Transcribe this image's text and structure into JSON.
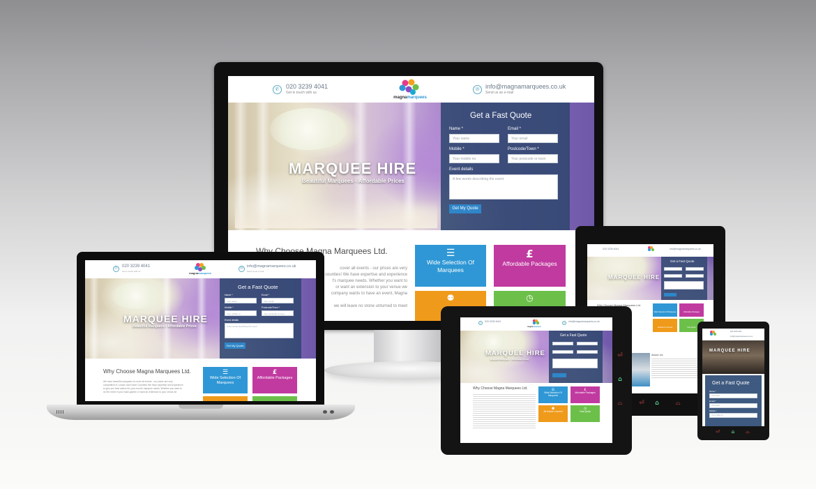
{
  "brand": {
    "logo_text_prefix": "magna",
    "logo_text_suffix": "marquees",
    "colors": {
      "teal": "#5fa9c0",
      "quote_panel": "#304870",
      "button": "#2f86c8",
      "tile_blue": "#2f97d5",
      "tile_magenta": "#c13aa0",
      "tile_orange": "#ef9a1a",
      "tile_green": "#6cc04a"
    }
  },
  "header": {
    "phone": "020 3239 4041",
    "phone_caption": "Get in touch with us",
    "email": "info@magnamarquees.co.uk",
    "email_caption": "Send us an e-mail",
    "phone_icon": "phone-icon",
    "email_icon": "mail-icon"
  },
  "hero": {
    "title": "MARQUEE HIRE",
    "subtitle": "Beautiful Marquees - Affordable Prices"
  },
  "quote_form": {
    "heading": "Get a Fast Quote",
    "name_label": "Name *",
    "name_placeholder": "Your name",
    "email_label": "Email *",
    "email_placeholder": "Your email",
    "mobile_label": "Mobile *",
    "mobile_placeholder": "Your mobile no.",
    "postcode_label": "Postcode/Town *",
    "postcode_placeholder": "Your postcode or town",
    "details_label": "Event details",
    "details_placeholder": "A few words describing the event",
    "submit_label": "Get My Quote"
  },
  "why": {
    "heading": "Why Choose Magna Marquees Ltd.",
    "text_lines": [
      "cover all events - our prices are very",
      "counties! We have expertise and experience",
      "t's marquee needs. Whether you want to",
      "or want an extension to your venue we",
      "company wants to have an event, Magna",
      "",
      "we will leave no stone unturned to meet"
    ],
    "laptop_text_lines": [
      "We have beautiful marquees to cover all events - our prices are very",
      "competitive in London and Home Counties! We have expertise and experience",
      "to give you best advice for your event's marquee needs. Whether you want to",
      "do the event in your back garden or want an extension to your venue we"
    ]
  },
  "tiles": [
    {
      "label": "Wide Selection Of Marquees",
      "icon": "list-icon",
      "glyph": "☰"
    },
    {
      "label": "Affordable Packages",
      "icon": "pound-icon",
      "glyph": "£"
    },
    {
      "label": "All Events Covered",
      "icon": "people-icon",
      "glyph": "●"
    },
    {
      "label": "Fast Quote",
      "icon": "clock-icon",
      "glyph": "◷"
    }
  ],
  "about": {
    "heading": "About Us"
  },
  "tablet_nav": {
    "back_icon": "back-icon",
    "home_icon": "home-icon",
    "recent_icon": "recent-apps-icon"
  },
  "laptop": {
    "keyboard_icon": "keyboard-grille-icon"
  }
}
